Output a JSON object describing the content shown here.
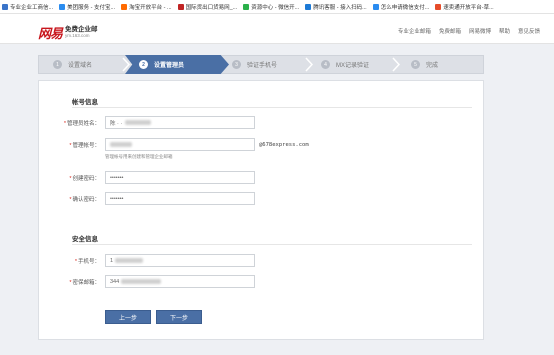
{
  "bookmarks": [
    {
      "label": "专业企业工商信...",
      "color": "#3a74c9"
    },
    {
      "label": "美团服务 - 支付宝...",
      "color": "#2a8cf0"
    },
    {
      "label": "淘宝开放平台 - ...",
      "color": "#ff6a00"
    },
    {
      "label": "国际货出口货易网_...",
      "color": "#c02424"
    },
    {
      "label": "资源中心 - 微信开...",
      "color": "#2ab04a"
    },
    {
      "label": "腾讯客服 - 接入扫码...",
      "color": "#1c7ad6"
    },
    {
      "label": "怎么申请微信支付...",
      "color": "#2a8cf0"
    },
    {
      "label": "速卖通开放平台-草...",
      "color": "#e64c2a"
    }
  ],
  "header": {
    "logo_main": "网易",
    "logo_sub": "免费企业邮",
    "logo_url": "ym.163.com",
    "nav": [
      "专业企业邮箱",
      "免费邮箱",
      "网易微博",
      "帮助",
      "意见反馈"
    ]
  },
  "stepper": {
    "steps": [
      {
        "num": "1",
        "label": "设置域名"
      },
      {
        "num": "2",
        "label": "设置管理员"
      },
      {
        "num": "3",
        "label": "验证手机号"
      },
      {
        "num": "4",
        "label": "MX记录验证"
      },
      {
        "num": "5",
        "label": "完成"
      }
    ],
    "active": 1
  },
  "account": {
    "title": "帐号信息",
    "admin_name_label": "管理员姓名：",
    "admin_name_value": "陈 · ·",
    "admin_account_label": "管理帐号：",
    "admin_account_value": "",
    "admin_account_suffix": "@678express.com",
    "admin_account_hint": "管理帐号用来创建和管理企业邮箱",
    "password_label": "创建密码：",
    "password_value": "•••••••",
    "confirm_label": "确认密码：",
    "confirm_value": "•••••••"
  },
  "security": {
    "title": "安全信息",
    "phone_label": "手机号：",
    "phone_value": "1",
    "email_label": "密保邮箱：",
    "email_value": "344"
  },
  "buttons": {
    "prev": "上一步",
    "next": "下一步"
  }
}
